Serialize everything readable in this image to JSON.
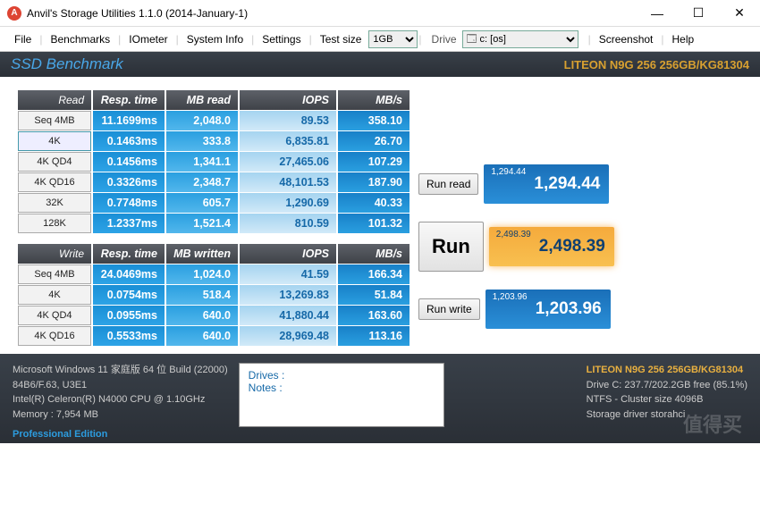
{
  "window": {
    "title": "Anvil's Storage Utilities 1.1.0 (2014-January-1)",
    "icon_letter": "A"
  },
  "menu": {
    "file": "File",
    "benchmarks": "Benchmarks",
    "iometer": "IOmeter",
    "sysinfo": "System Info",
    "settings": "Settings",
    "testsize": "Test size",
    "size_sel": "1GB",
    "drive_lbl": "Drive",
    "drive_sel": "🗔 c: [os]",
    "screenshot": "Screenshot",
    "help": "Help"
  },
  "header": {
    "title": "SSD Benchmark",
    "device": "LITEON N9G  256 256GB/KG81304"
  },
  "chart_data": {
    "type": "table",
    "read": {
      "columns": [
        "Read",
        "Resp. time",
        "MB read",
        "IOPS",
        "MB/s"
      ],
      "rows": [
        {
          "label": "Seq 4MB",
          "resp": "11.1699ms",
          "mb": "2,048.0",
          "iops": "89.53",
          "mbs": "358.10"
        },
        {
          "label": "4K",
          "resp": "0.1463ms",
          "mb": "333.8",
          "iops": "6,835.81",
          "mbs": "26.70"
        },
        {
          "label": "4K QD4",
          "resp": "0.1456ms",
          "mb": "1,341.1",
          "iops": "27,465.06",
          "mbs": "107.29"
        },
        {
          "label": "4K QD16",
          "resp": "0.3326ms",
          "mb": "2,348.7",
          "iops": "48,101.53",
          "mbs": "187.90"
        },
        {
          "label": "32K",
          "resp": "0.7748ms",
          "mb": "605.7",
          "iops": "1,290.69",
          "mbs": "40.33"
        },
        {
          "label": "128K",
          "resp": "1.2337ms",
          "mb": "1,521.4",
          "iops": "810.59",
          "mbs": "101.32"
        }
      ]
    },
    "write": {
      "columns": [
        "Write",
        "Resp. time",
        "MB written",
        "IOPS",
        "MB/s"
      ],
      "rows": [
        {
          "label": "Seq 4MB",
          "resp": "24.0469ms",
          "mb": "1,024.0",
          "iops": "41.59",
          "mbs": "166.34"
        },
        {
          "label": "4K",
          "resp": "0.0754ms",
          "mb": "518.4",
          "iops": "13,269.83",
          "mbs": "51.84"
        },
        {
          "label": "4K QD4",
          "resp": "0.0955ms",
          "mb": "640.0",
          "iops": "41,880.44",
          "mbs": "163.60"
        },
        {
          "label": "4K QD16",
          "resp": "0.5533ms",
          "mb": "640.0",
          "iops": "28,969.48",
          "mbs": "113.16"
        }
      ]
    }
  },
  "buttons": {
    "run_read": "Run read",
    "run": "Run",
    "run_write": "Run write"
  },
  "scores": {
    "read": "1,294.44",
    "read_mini": "1,294.44",
    "total": "2,498.39",
    "total_mini": "2,498.39",
    "write": "1,203.96",
    "write_mini": "1,203.96"
  },
  "footer": {
    "os": "Microsoft Windows 11 家庭版 64 位 Build (22000)",
    "sys": "84B6/F.63, U3E1",
    "cpu": "Intel(R) Celeron(R) N4000 CPU @ 1.10GHz",
    "mem": "Memory : 7,954 MB",
    "edition": "Professional Edition",
    "drives_lbl": "Drives :",
    "notes_lbl": "Notes :",
    "device": "LITEON N9G  256 256GB/KG81304",
    "drive_c": "Drive C: 237.7/202.2GB free (85.1%)",
    "ntfs": "NTFS - Cluster size 4096B",
    "storage": "Storage driver   storahci",
    "watermark": "值得买"
  }
}
